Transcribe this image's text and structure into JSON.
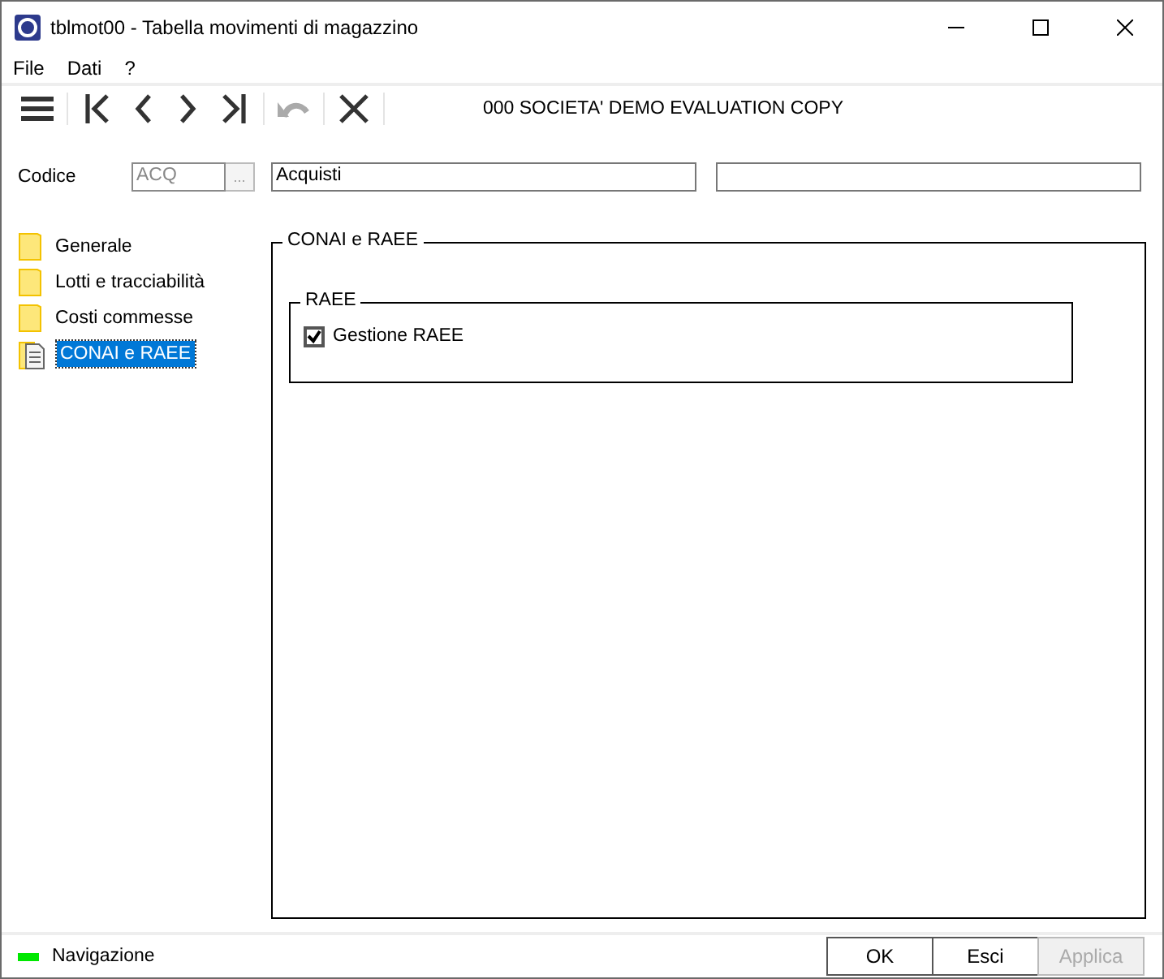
{
  "window": {
    "title": "tblmot00 - Tabella movimenti di magazzino"
  },
  "menu": [
    "File",
    "Dati",
    "?"
  ],
  "toolbar": {
    "buttons": [
      {
        "kind": "menu",
        "disabled": false
      },
      {
        "kind": "first",
        "disabled": false
      },
      {
        "kind": "prev",
        "disabled": false
      },
      {
        "kind": "next",
        "disabled": false
      },
      {
        "kind": "last",
        "disabled": false
      },
      {
        "kind": "undo",
        "disabled": true
      },
      {
        "kind": "close",
        "disabled": false
      }
    ],
    "company": "000 SOCIETA'  DEMO EVALUATION COPY"
  },
  "codice": {
    "label": "Codice",
    "code": "ACQ",
    "lookup": "...",
    "description": "Acquisti"
  },
  "tree": [
    {
      "label": "Generale",
      "selected": false
    },
    {
      "label": "Lotti e tracciabilità",
      "selected": false
    },
    {
      "label": "Costi commesse",
      "selected": false
    },
    {
      "label": "CONAI e RAEE",
      "selected": true
    }
  ],
  "panel": {
    "title": "CONAI e RAEE",
    "group": {
      "title": "RAEE",
      "checkbox": {
        "label": "Gestione RAEE",
        "checked": true
      }
    }
  },
  "status": {
    "text": "Navigazione"
  },
  "buttons": [
    {
      "label": "OK",
      "disabled": false
    },
    {
      "label": "Esci",
      "disabled": false
    },
    {
      "label": "Applica",
      "disabled": true
    }
  ]
}
